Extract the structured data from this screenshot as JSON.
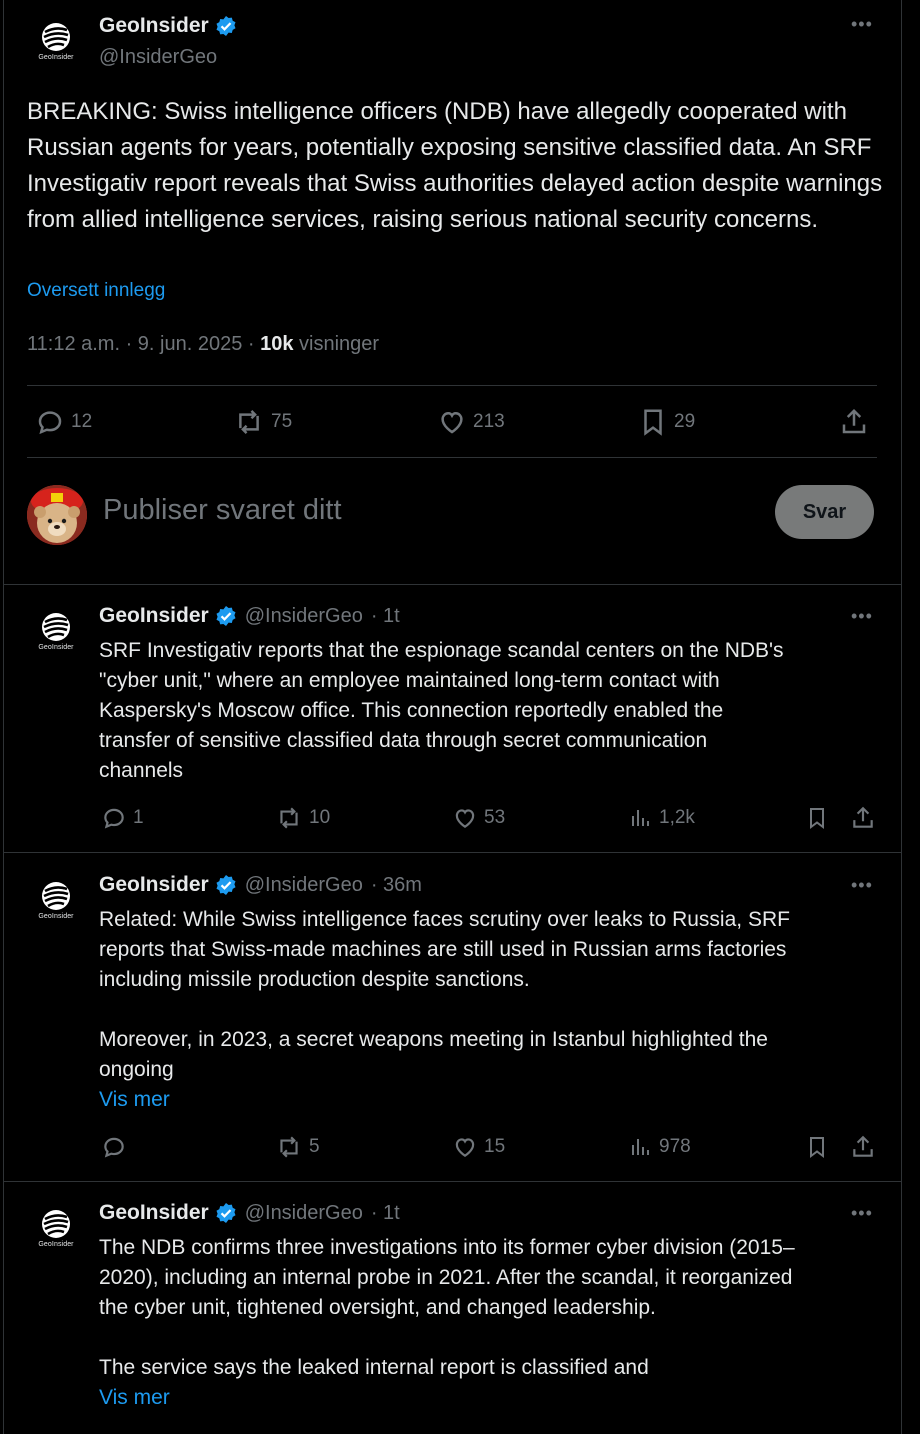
{
  "main": {
    "name": "GeoInsider",
    "handle": "@InsiderGeo",
    "logo_text": "GeoInsider",
    "text": "BREAKING: Swiss intelligence officers (NDB) have allegedly cooperated with Russian agents for years, potentially exposing sensitive classified data. An SRF Investigativ report reveals that Swiss authorities delayed action despite warnings from allied intelligence services, raising serious national security concerns.",
    "translate": "Oversett innlegg",
    "time": "11:12 a.m. · 9. jun. 2025 · ",
    "views": "10k",
    "views_label": " visninger",
    "replies": "12",
    "reposts": "75",
    "likes": "213",
    "bookmarks": "29"
  },
  "composer": {
    "placeholder": "Publiser svaret ditt",
    "button": "Svar"
  },
  "replies": [
    {
      "name": "GeoInsider",
      "handle": "@InsiderGeo",
      "time": "· 1t",
      "logo_text": "GeoInsider",
      "lines": [
        "SRF Investigativ reports that the espionage scandal centers on the NDB's",
        "\"cyber unit,\" where an employee maintained long-term contact with",
        "Kaspersky's Moscow office. This connection reportedly enabled the",
        "transfer of sensitive classified data through secret communication",
        "channels"
      ],
      "show_more": "",
      "replies": "1",
      "reposts": "10",
      "likes": "53",
      "views": "1,2k"
    },
    {
      "name": "GeoInsider",
      "handle": "@InsiderGeo",
      "time": "· 36m",
      "logo_text": "GeoInsider",
      "lines": [
        "Related: While Swiss intelligence faces scrutiny over leaks to Russia, SRF",
        "reports that Swiss-made machines are still used in Russian arms factories",
        "including missile production  despite sanctions.",
        "",
        "Moreover, in 2023, a secret weapons meeting in Istanbul highlighted the",
        "ongoing"
      ],
      "show_more": "Vis mer",
      "replies": "",
      "reposts": "5",
      "likes": "15",
      "views": "978"
    },
    {
      "name": "GeoInsider",
      "handle": "@InsiderGeo",
      "time": "· 1t",
      "logo_text": "GeoInsider",
      "lines": [
        "The NDB confirms three investigations into its former cyber division (2015–",
        "2020), including an internal probe in 2021. After the scandal, it reorganized",
        "the cyber unit, tightened oversight, and changed leadership.",
        "",
        "The service says the leaked internal report is classified and"
      ],
      "show_more": "Vis mer"
    }
  ]
}
